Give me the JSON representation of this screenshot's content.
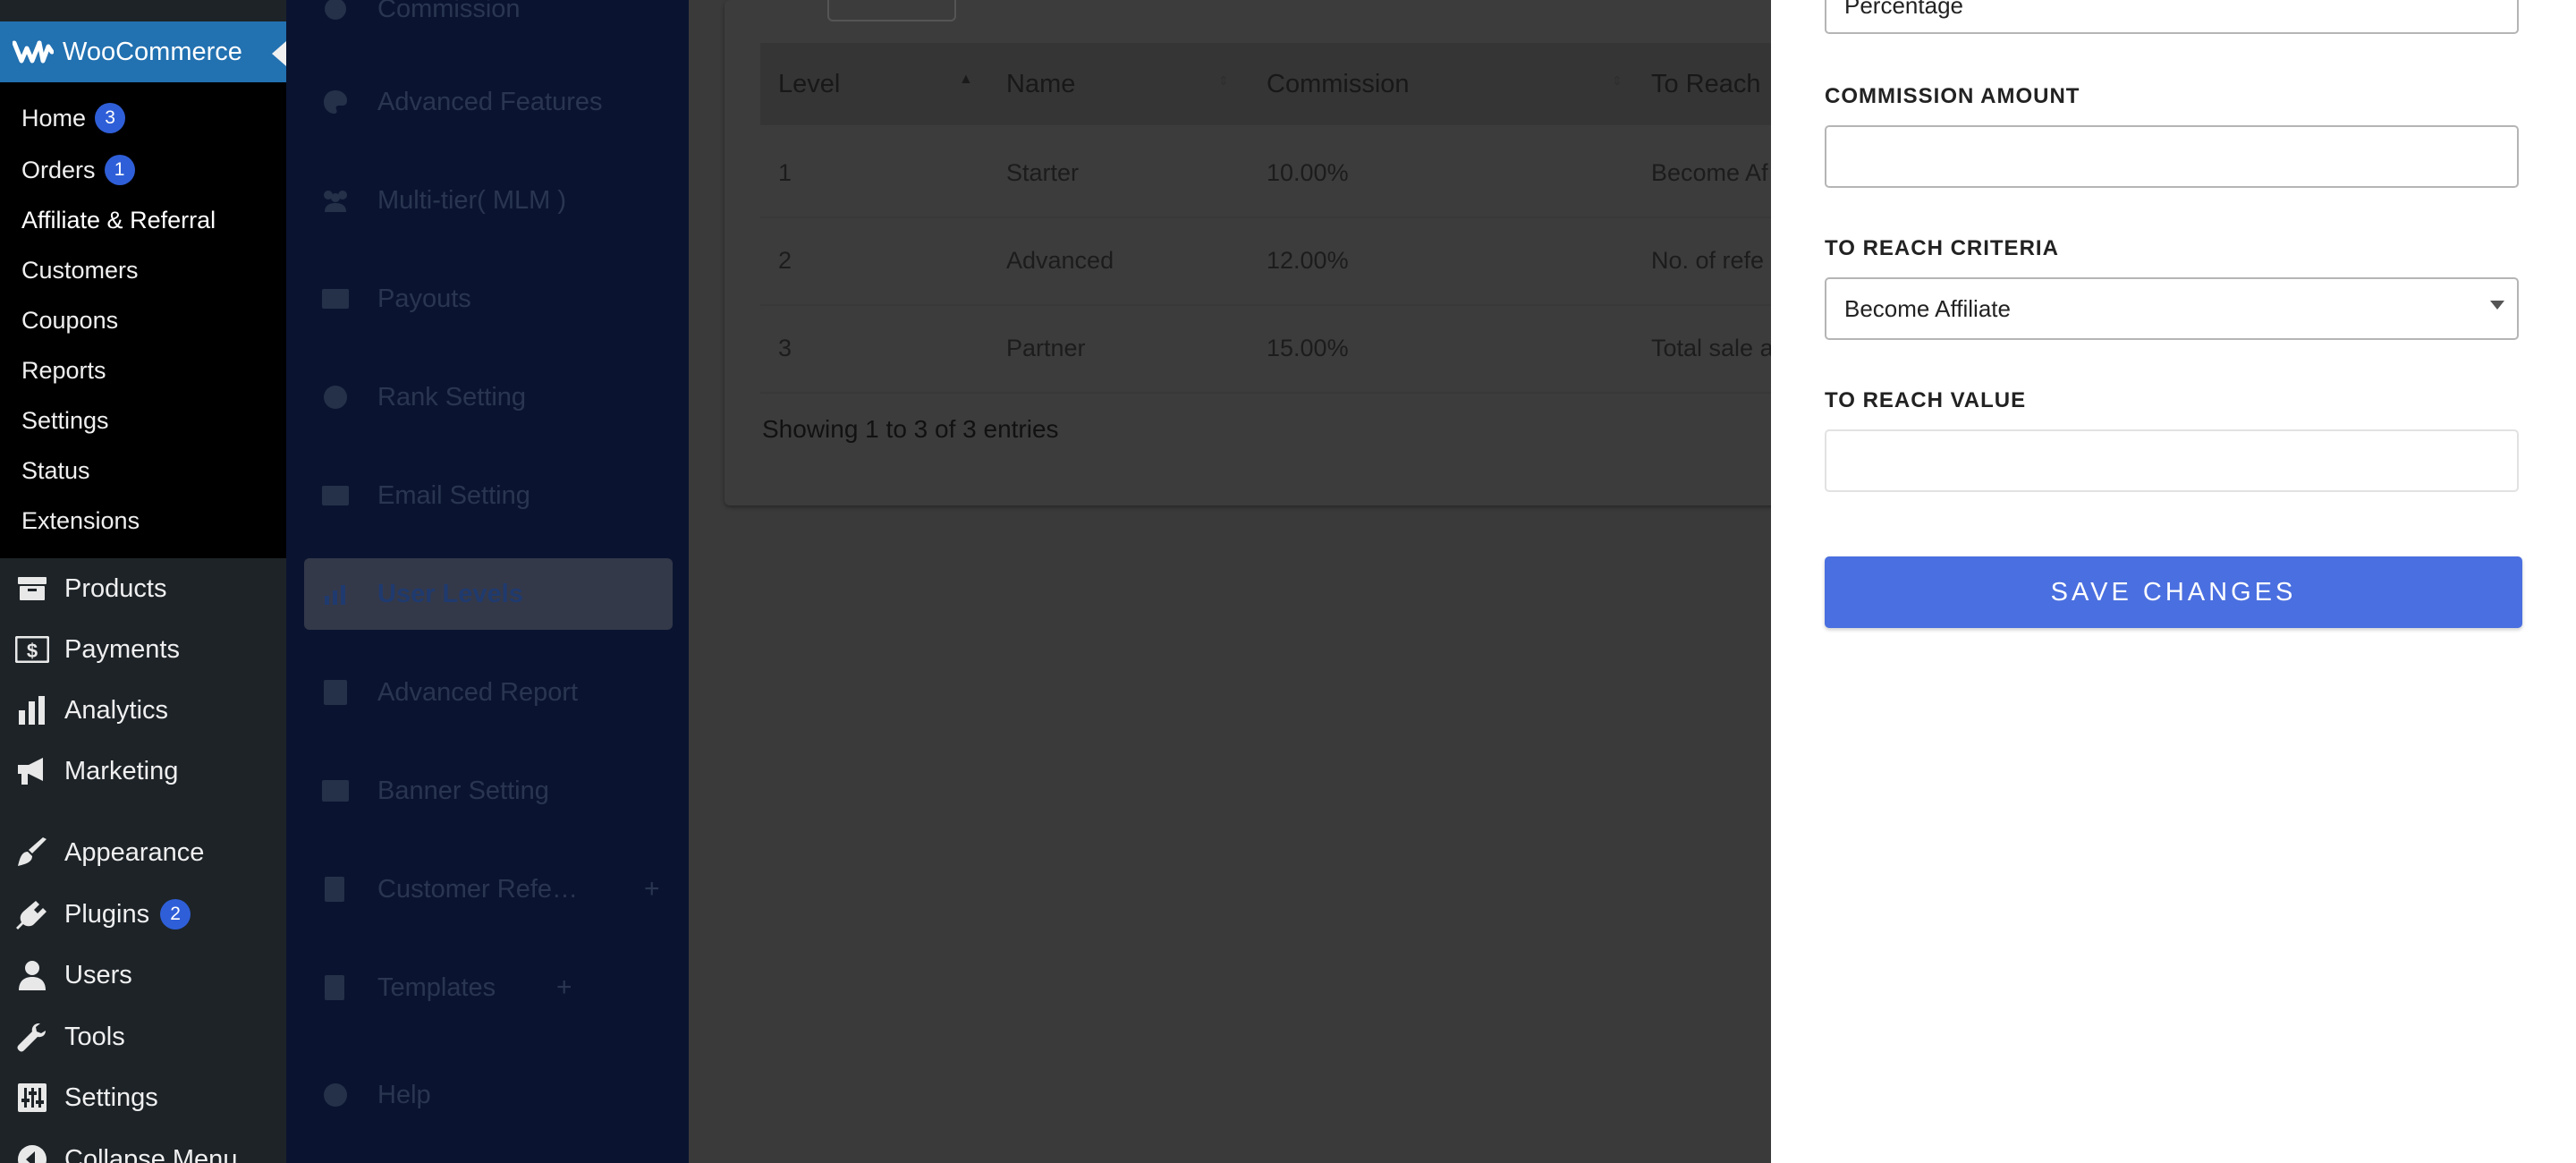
{
  "wp_menu": {
    "wc_title": "WooCommerce",
    "submenu": [
      {
        "label": "Home",
        "badge": "3"
      },
      {
        "label": "Orders",
        "badge": "1"
      },
      {
        "label": "Affiliate & Referral",
        "badge": ""
      },
      {
        "label": "Customers",
        "badge": ""
      },
      {
        "label": "Coupons",
        "badge": ""
      },
      {
        "label": "Reports",
        "badge": ""
      },
      {
        "label": "Settings",
        "badge": ""
      },
      {
        "label": "Status",
        "badge": ""
      },
      {
        "label": "Extensions",
        "badge": ""
      }
    ],
    "items": [
      {
        "label": "Products",
        "icon": "archive-icon",
        "badge": ""
      },
      {
        "label": "Payments",
        "icon": "dollar-icon",
        "badge": ""
      },
      {
        "label": "Analytics",
        "icon": "bar-chart-icon",
        "badge": ""
      },
      {
        "label": "Marketing",
        "icon": "megaphone-icon",
        "badge": ""
      },
      {
        "label": "Appearance",
        "icon": "paintbrush-icon",
        "badge": ""
      },
      {
        "label": "Plugins",
        "icon": "plug-icon",
        "badge": "2"
      },
      {
        "label": "Users",
        "icon": "user-icon",
        "badge": ""
      },
      {
        "label": "Tools",
        "icon": "wrench-icon",
        "badge": ""
      },
      {
        "label": "Settings",
        "icon": "sliders-icon",
        "badge": ""
      },
      {
        "label": "Collapse Menu",
        "icon": "collapse-icon",
        "badge": ""
      }
    ]
  },
  "plugin_nav": {
    "items": [
      {
        "label": "Commission"
      },
      {
        "label": "Advanced Features"
      },
      {
        "label": "Multi-tier( MLM )"
      },
      {
        "label": "Payouts"
      },
      {
        "label": "Rank Setting"
      },
      {
        "label": "Email Setting"
      },
      {
        "label": "User Levels"
      },
      {
        "label": "Advanced Report"
      },
      {
        "label": "Banner Setting"
      },
      {
        "label": "Customer Refe…"
      },
      {
        "label": "Templates"
      },
      {
        "label": "Help"
      }
    ],
    "plus": "+"
  },
  "table": {
    "headers": [
      "Level",
      "Name",
      "Commission",
      "To Reach"
    ],
    "rows": [
      [
        "1",
        "Starter",
        "10.00%",
        "Become Af"
      ],
      [
        "2",
        "Advanced",
        "12.00%",
        "No. of refe"
      ],
      [
        "3",
        "Partner",
        "15.00%",
        "Total sale a"
      ]
    ],
    "footer": "Showing 1 to 3 of 3 entries"
  },
  "drawer": {
    "commission_type_value": "Percentage",
    "commission_amount_label": "COMMISSION AMOUNT",
    "commission_amount_value": "",
    "to_reach_criteria_label": "TO REACH CRITERIA",
    "to_reach_criteria_value": "Become Affiliate",
    "to_reach_value_label": "TO REACH VALUE",
    "to_reach_value_value": "",
    "save_label": "SAVE CHANGES"
  },
  "colors": {
    "wp_menu_bg": "#1d2327",
    "wc_header": "#2271b1",
    "badge": "#2f5fd8",
    "save_button": "#4a6fe0",
    "overlay_bg": "#3a3a3a"
  }
}
